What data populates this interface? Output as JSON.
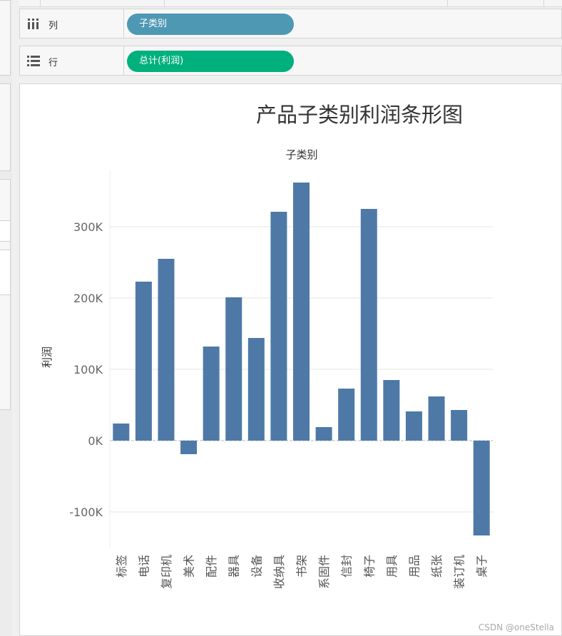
{
  "shelves": {
    "columns": {
      "name": "列",
      "pill": "子类别",
      "pill_color": "#4e98b4"
    },
    "rows": {
      "name": "行",
      "pill": "总计(利润)",
      "pill_color": "#00b07d"
    }
  },
  "watermark": "CSDN @oneStella",
  "chart_data": {
    "type": "bar",
    "title": "产品子类别利润条形图",
    "xlabel": "子类别",
    "ylabel": "利润",
    "bar_color": "#4e79a7",
    "ylim": [
      -150000,
      380000
    ],
    "yticks": [
      -100000,
      0,
      100000,
      200000,
      300000
    ],
    "ytick_labels": [
      "-100K",
      "0K",
      "100K",
      "200K",
      "300K"
    ],
    "categories": [
      "标签",
      "电话",
      "复印机",
      "美术",
      "配件",
      "器具",
      "设备",
      "收纳具",
      "书架",
      "系固件",
      "信封",
      "椅子",
      "用具",
      "用品",
      "纸张",
      "装订机",
      "桌子"
    ],
    "values": [
      24000,
      223000,
      255000,
      -19000,
      132000,
      201000,
      144000,
      321000,
      362000,
      19000,
      73000,
      325000,
      85000,
      41000,
      62000,
      43000,
      -133000
    ]
  }
}
